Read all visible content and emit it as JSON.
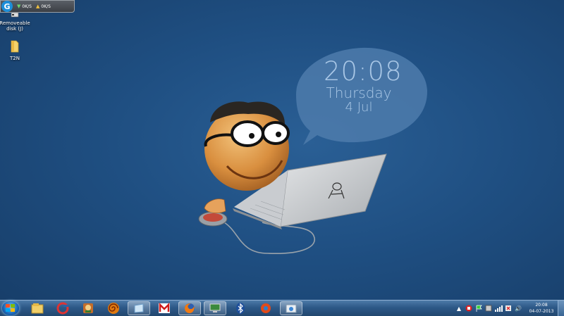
{
  "widget": {
    "logo_letter": "G",
    "download_speed": "0K/S",
    "upload_speed": "0K/S"
  },
  "desktop_icons": [
    {
      "label": "Removeable disk (J)",
      "icon": "removable-disk-icon"
    },
    {
      "label": "T2N",
      "icon": "folder-icon"
    }
  ],
  "clock_widget": {
    "time": "20:08",
    "day": "Thursday",
    "date": "4 Jul"
  },
  "taskbar": {
    "pinned": [
      {
        "name": "explorer",
        "icon": "folder-libraries-icon"
      },
      {
        "name": "ccleaner",
        "icon": "ccleaner-icon"
      },
      {
        "name": "game",
        "icon": "game-icon"
      },
      {
        "name": "spiral",
        "icon": "spiral-app-icon"
      },
      {
        "name": "window",
        "icon": "window-app-icon"
      },
      {
        "name": "mcafee",
        "icon": "m-logo-icon"
      },
      {
        "name": "firefox",
        "icon": "firefox-icon"
      },
      {
        "name": "monitor",
        "icon": "monitor-app-icon"
      },
      {
        "name": "bluetooth",
        "icon": "bluetooth-icon"
      },
      {
        "name": "browser",
        "icon": "browser-icon"
      },
      {
        "name": "control-panel",
        "icon": "control-panel-icon"
      }
    ],
    "tray": {
      "time": "20:08",
      "date": "04-07-2013"
    }
  },
  "colors": {
    "desktop_bg": "#1f4f82",
    "taskbar": "#2d5887",
    "clock_text": "#a9c7e6"
  }
}
